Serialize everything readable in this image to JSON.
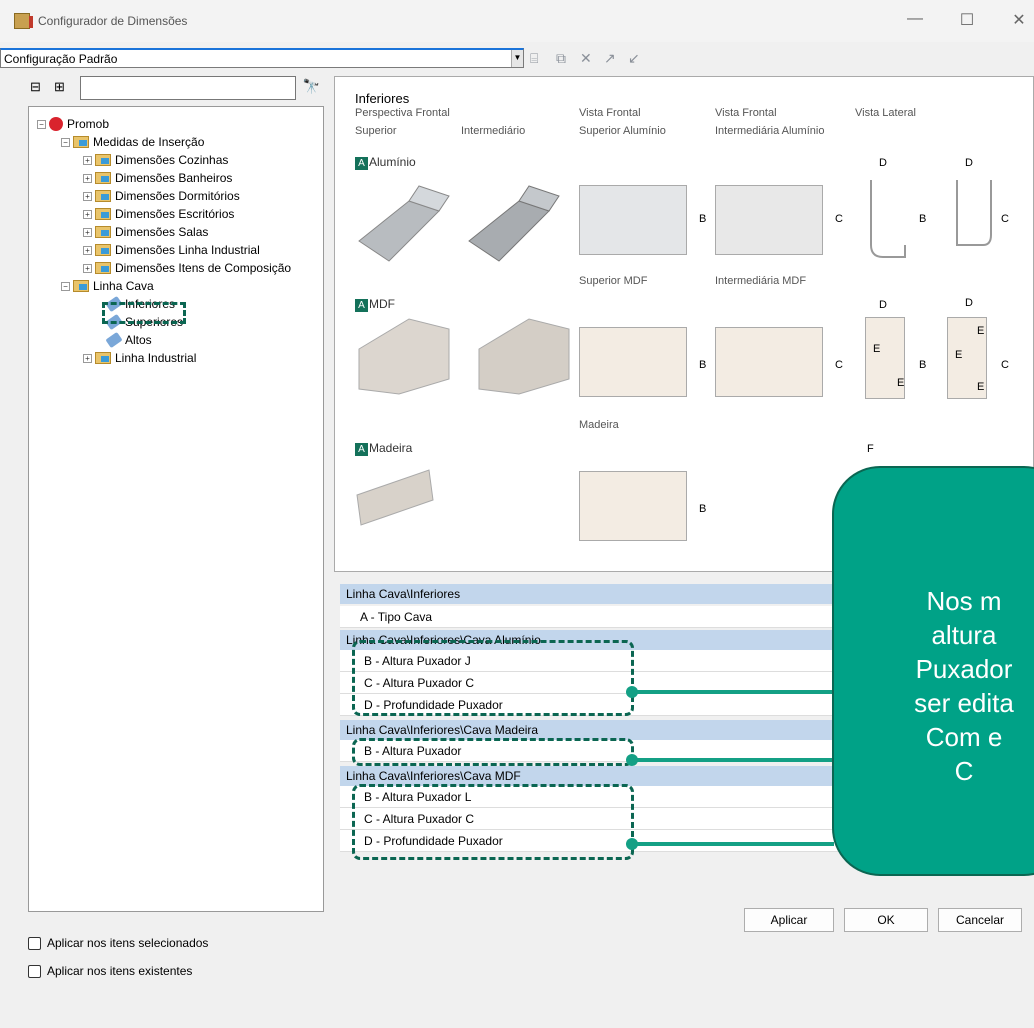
{
  "window": {
    "title": "Configurador de Dimensões",
    "minimize": "—",
    "maximize": "☐",
    "close": "✕"
  },
  "toolbar": {
    "config_value": "Configuração Padrão"
  },
  "tree": {
    "search_value": "",
    "nodes": [
      {
        "label": "Promob",
        "icon": "promob-icon"
      },
      {
        "label": "Medidas de Inserção",
        "icon": "folder-icon"
      },
      {
        "label": "Dimensões Cozinhas",
        "icon": "folder-icon"
      },
      {
        "label": "Dimensões Banheiros",
        "icon": "folder-icon"
      },
      {
        "label": "Dimensões Dormitórios",
        "icon": "folder-icon"
      },
      {
        "label": "Dimensões Escritórios",
        "icon": "folder-icon"
      },
      {
        "label": "Dimensões Salas",
        "icon": "folder-icon"
      },
      {
        "label": "Dimensões Linha Industrial",
        "icon": "folder-icon"
      },
      {
        "label": "Dimensões Itens de Composição",
        "icon": "folder-icon"
      },
      {
        "label": "Linha Cava",
        "icon": "folder-icon"
      },
      {
        "label": "Inferiores",
        "icon": "leaf-icon"
      },
      {
        "label": "Superiores",
        "icon": "leaf-icon"
      },
      {
        "label": "Altos",
        "icon": "leaf-icon"
      },
      {
        "label": "Linha Industrial",
        "icon": "folder-icon"
      }
    ]
  },
  "options": {
    "apply_selected": "Aplicar nos itens selecionados",
    "apply_existing": "Aplicar nos itens existentes"
  },
  "preview": {
    "title": "Inferiores",
    "perspectiva": "Perspectiva Frontal",
    "vista_frontal_1": "Vista Frontal",
    "vista_frontal_2": "Vista Frontal",
    "vista_lateral": "Vista Lateral",
    "superior": "Superior",
    "intermediario": "Intermediário",
    "superior_aluminio": "Superior Alumínio",
    "intermediaria_aluminio": "Intermediária Alumínio",
    "superior_mdf": "Superior MDF",
    "intermediaria_mdf": "Intermediária MDF",
    "madeira_head": "Madeira",
    "badge": "A",
    "aluminio": "Alumínio",
    "mdf": "MDF",
    "madeira": "Madeira",
    "dim_b": "B",
    "dim_c": "C",
    "dim_d": "D",
    "dim_e": "E",
    "dim_f": "F"
  },
  "grid": {
    "groups": [
      "Linha Cava\\Inferiores",
      "Linha Cava\\Inferiores\\Cava Alumínio",
      "Linha Cava\\Inferiores\\Cava Madeira",
      "Linha Cava\\Inferiores\\Cava MDF"
    ],
    "rows": [
      "A - Tipo Cava",
      "B - Altura Puxador J",
      "C - Altura Puxador C",
      "D - Profundidade Puxador",
      "B - Altura Puxador",
      "B - Altura Puxador L",
      "C - Altura Puxador C",
      "D - Profundidade Puxador"
    ]
  },
  "callout": {
    "text": "Nos m\naltura\nPuxador\nser edita\nCom e\nC",
    "color": "#00a287"
  },
  "buttons": {
    "apply": "Aplicar",
    "ok": "OK",
    "cancel": "Cancelar"
  }
}
